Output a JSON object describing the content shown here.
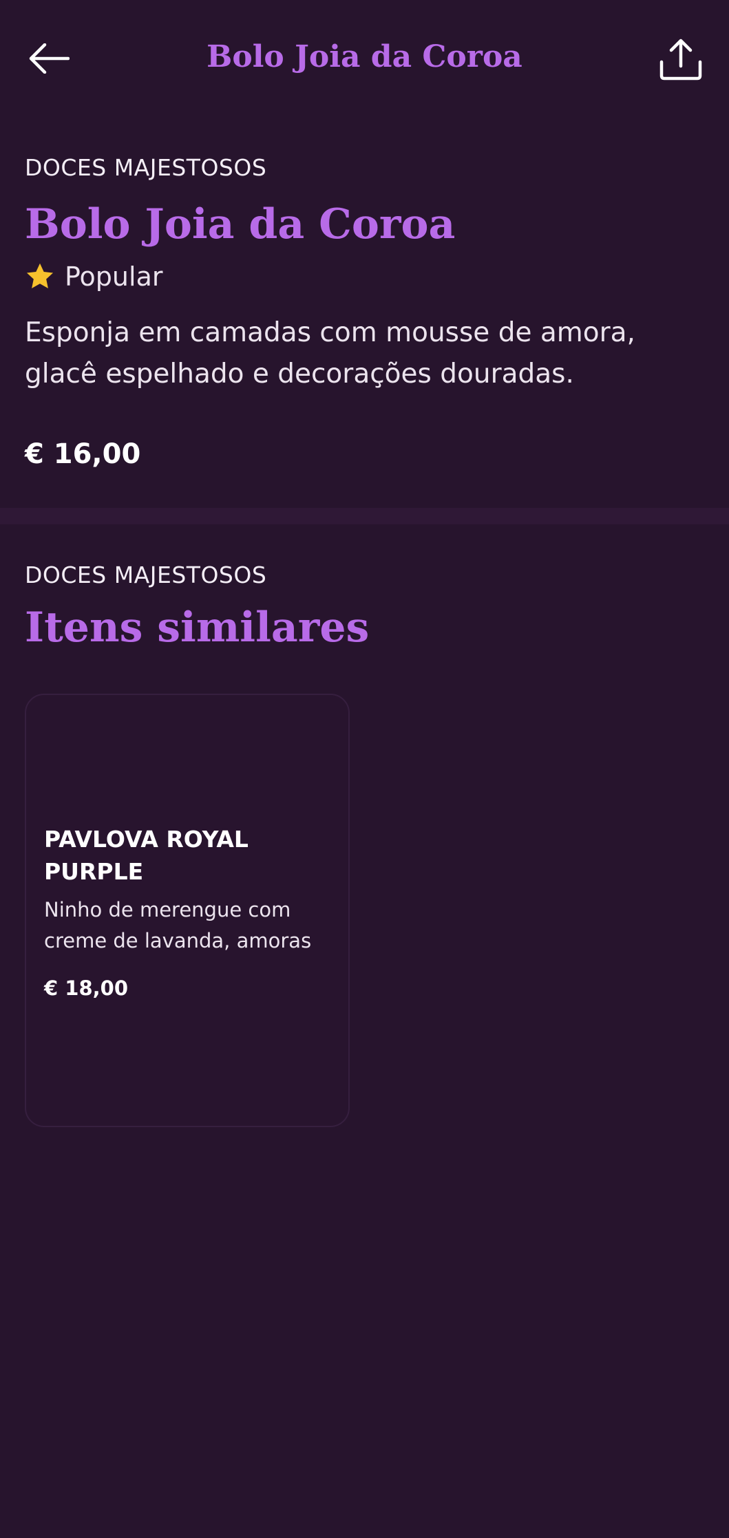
{
  "colors": {
    "background": "#27142d",
    "accent": "#b86be8",
    "text": "#ffffff",
    "star": "#f6c12d",
    "divider": "#2f1836",
    "card_border": "#361f3f"
  },
  "header": {
    "title": "Bolo Joia da Coroa",
    "back_icon": "arrow-left-icon",
    "share_icon": "share-upload-icon"
  },
  "product": {
    "category": "DOCES MAJESTOSOS",
    "title": "Bolo Joia da Coroa",
    "badge": {
      "icon": "star-icon",
      "label": "Popular"
    },
    "description": "Esponja em camadas com mousse de amora, glacê espelhado e decorações douradas.",
    "price": "€ 16,00"
  },
  "similar": {
    "category": "DOCES MAJESTOSOS",
    "title": "Itens similares",
    "items": [
      {
        "name": "PAVLOVA ROYAL PURPLE",
        "description": "Ninho de merengue com creme de lavanda, amoras ...",
        "price": "€ 18,00"
      }
    ]
  }
}
